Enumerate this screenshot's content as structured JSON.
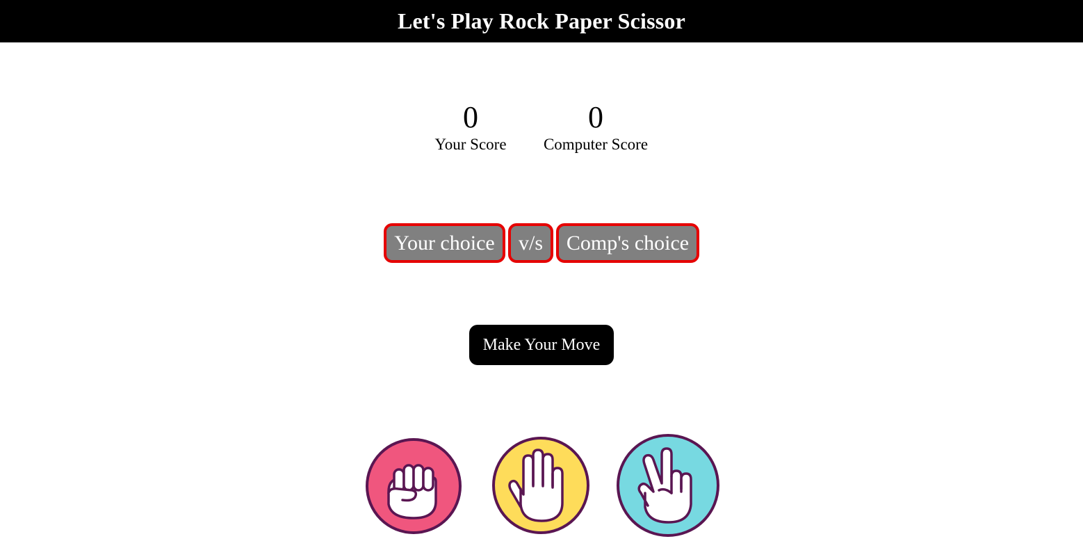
{
  "header": {
    "title": "Let's Play Rock Paper Scissor"
  },
  "scoreboard": {
    "user_score": "0",
    "user_label": "Your Score",
    "comp_score": "0",
    "comp_label": "Computer Score"
  },
  "message": {
    "your_choice": "Your choice",
    "vs": "v/s",
    "comp_choice": "Comp's choice"
  },
  "move_button": {
    "label": "Make Your Move"
  },
  "choices": [
    {
      "name": "rock",
      "icon": "fist-icon",
      "color": "#f0567e"
    },
    {
      "name": "paper",
      "icon": "open-hand-icon",
      "color": "#fedc5a"
    },
    {
      "name": "scissors",
      "icon": "peace-hand-icon",
      "color": "#77d9e1"
    }
  ],
  "colors": {
    "header_bg": "#000000",
    "pill_bg": "#808080",
    "pill_border": "#e60000",
    "icon_outline": "#5a1652"
  }
}
